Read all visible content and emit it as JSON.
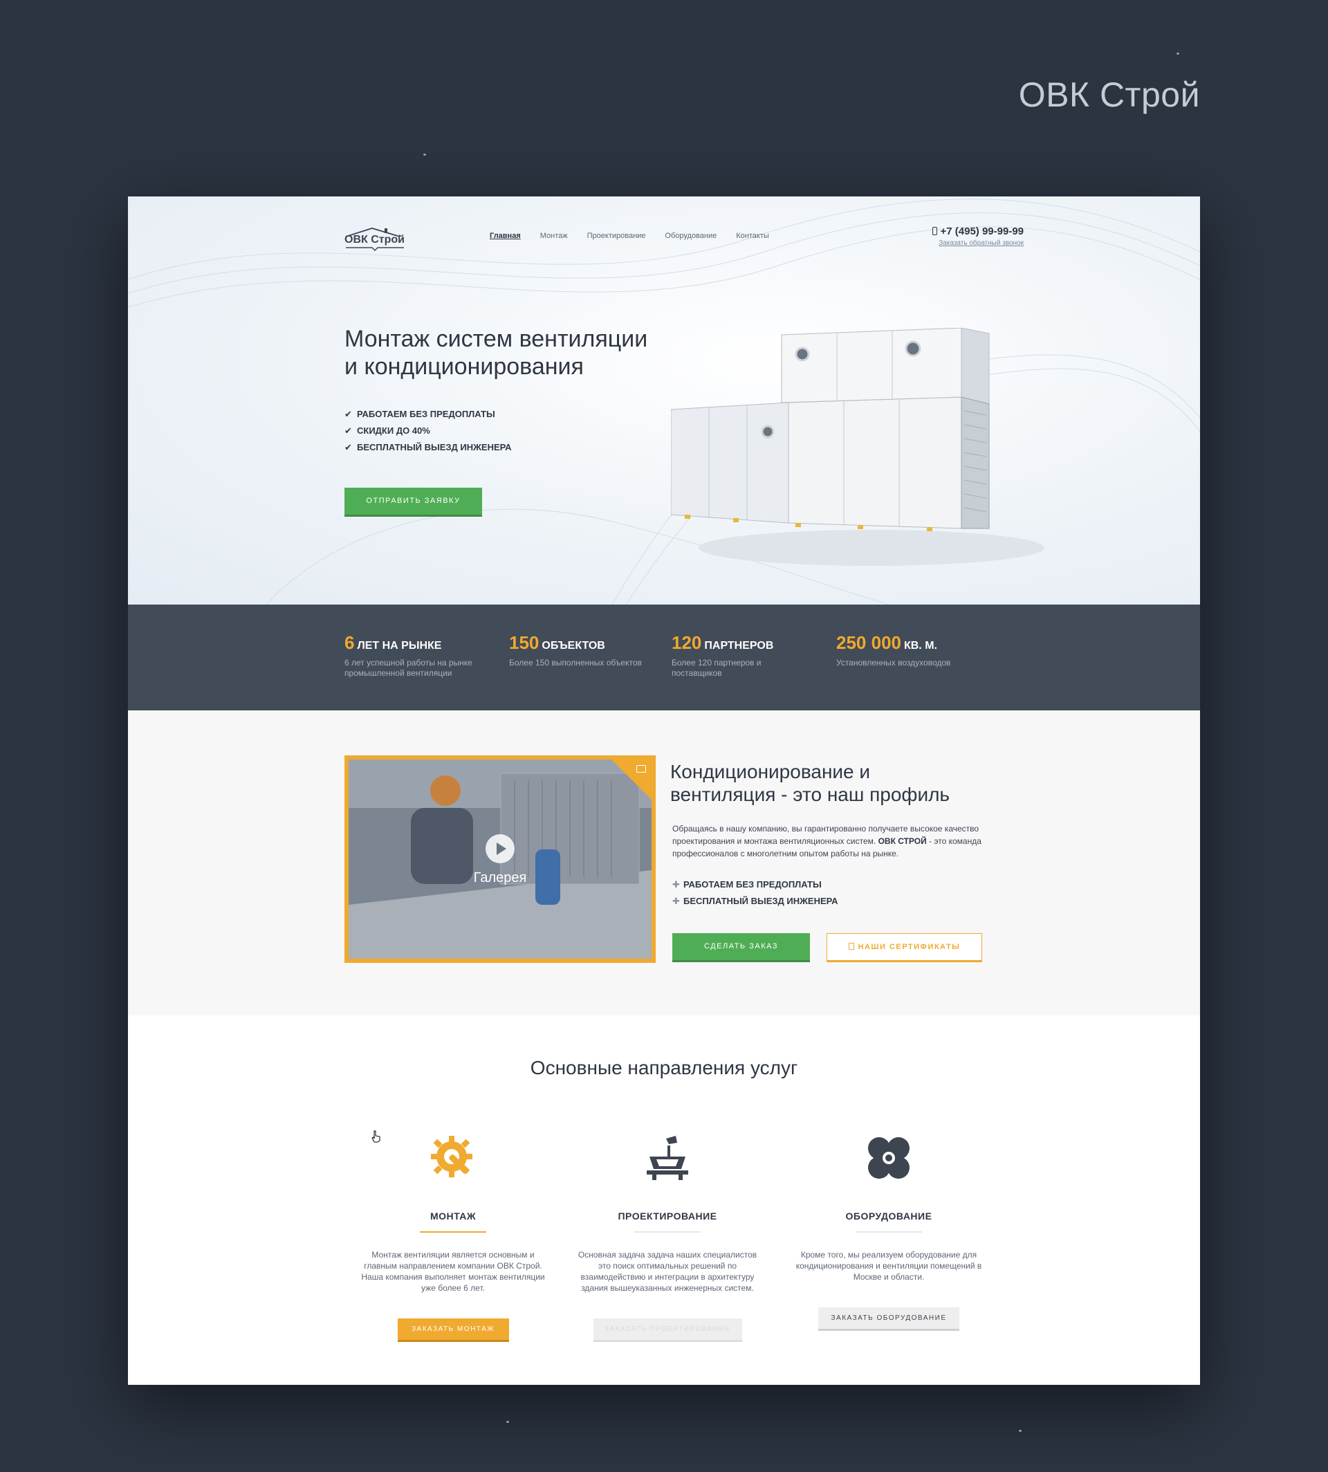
{
  "presentation_title": "ОВК Строй",
  "header": {
    "logo_text": "ОВК Строй",
    "nav": [
      "Главная",
      "Монтаж",
      "Проектирование",
      "Оборудование",
      "Контакты"
    ],
    "phone": "+7 (495) 99-99-99",
    "callback": "Заказать обратный звонок"
  },
  "hero": {
    "title_line1": "Монтаж систем вентиляции",
    "title_line2": "и кондиционирования",
    "features": [
      "РАБОТАЕМ БЕЗ ПРЕДОПЛАТЫ",
      "СКИДКИ ДО 40%",
      "БЕСПЛАТНЫЙ ВЫЕЗД ИНЖЕНЕРА"
    ],
    "button": "ОТПРАВИТЬ ЗАЯВКУ"
  },
  "stats": [
    {
      "number": "6",
      "label": "ЛЕТ НА РЫНКЕ",
      "desc": "6 лет успешной работы на рынке промышленной вентиляции"
    },
    {
      "number": "150",
      "label": "ОБЪЕКТОВ",
      "desc": "Более 150 выполненных объектов"
    },
    {
      "number": "120",
      "label": "ПАРТНЕРОВ",
      "desc": "Более 120 партнеров и поставщиков"
    },
    {
      "number": "250 000",
      "label": "КВ. М.",
      "desc": "Установленных воздуховодов"
    }
  ],
  "profile": {
    "gallery_label": "Галерея",
    "title_line1": "Кондиционирование и",
    "title_line2": "вентиляция - это наш профиль",
    "text_part1": "Обращаясь в нашу компанию, вы гарантированно получаете высокое качество проектирования и монтажа вентиляционных систем.",
    "text_bold": "ОВК СТРОЙ",
    "text_part2": " - это команда профессионалов с многолетним опытом работы на рынке.",
    "features": [
      "РАБОТАЕМ БЕЗ ПРЕДОПЛАТЫ",
      "БЕСПЛАТНЫЙ ВЫЕЗД ИНЖЕНЕРА"
    ],
    "order_button": "СДЕЛАТЬ ЗАКАЗ",
    "cert_button": "НАШИ СЕРТИФИКАТЫ"
  },
  "services": {
    "title": "Основные направления услуг",
    "items": [
      {
        "name": "МОНТАЖ",
        "text": "Монтаж вентиляции является основным и главным направлением компании ОВК Строй. Наша компания выполняет монтаж вентиляции уже более 6 лет.",
        "button": "ЗАКАЗАТЬ МОНТАЖ"
      },
      {
        "name": "ПРОЕКТИРОВАНИЕ",
        "text": "Основная задача задача наших специалистов это поиск оптимальных решений по взаимодействию и интеграции в архитектуру здания вышеуказанных инженерных систем.",
        "button": "ЗАКАЗАТЬ ПРОЕКТИРОВАНИЕ"
      },
      {
        "name": "ОБОРУДОВАНИЕ",
        "text": "Кроме того, мы реализуем оборудование для кондиционирования и вентиляции помещений в Москве и области.",
        "button": "ЗАКАЗАТЬ ОБОРУДОВАНИЕ"
      }
    ]
  },
  "colors": {
    "background": "#2b3441",
    "accent_orange": "#efaa2f",
    "accent_green": "#4fae55",
    "stats_band": "#424b58",
    "text_dark": "#2f3743"
  }
}
